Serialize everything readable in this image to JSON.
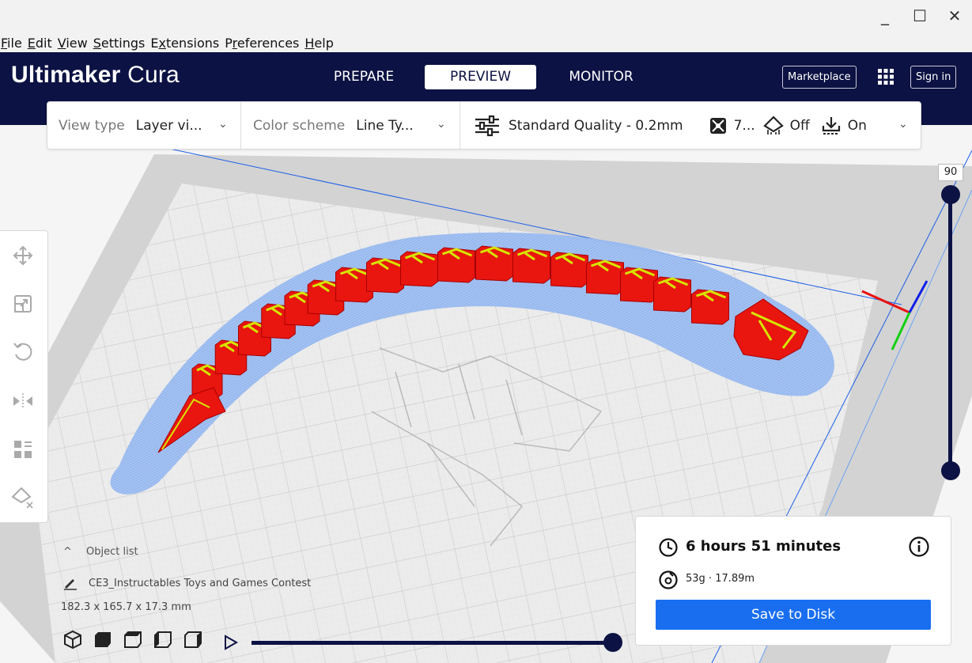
{
  "window": {
    "min": "_",
    "max": "☐",
    "close": "✕"
  },
  "menu": [
    {
      "pre": "",
      "key": "F",
      "post": "ile"
    },
    {
      "pre": "",
      "key": "E",
      "post": "dit"
    },
    {
      "pre": "",
      "key": "V",
      "post": "iew"
    },
    {
      "pre": "",
      "key": "S",
      "post": "ettings"
    },
    {
      "pre": "E",
      "key": "x",
      "post": "tensions"
    },
    {
      "pre": "P",
      "key": "r",
      "post": "eferences"
    },
    {
      "pre": "",
      "key": "H",
      "post": "elp"
    }
  ],
  "header": {
    "brand_bold": "Ultimaker",
    "brand_light": "Cura",
    "tabs": {
      "prepare": "PREPARE",
      "preview": "PREVIEW",
      "monitor": "MONITOR"
    },
    "marketplace": "Marketplace",
    "signin": "Sign in"
  },
  "settings": {
    "view_type_label": "View type",
    "view_type_value": "Layer vi...",
    "color_scheme_label": "Color scheme",
    "color_scheme_value": "Line Ty...",
    "quality": "Standard Quality - 0.2mm",
    "infill": "7...",
    "support": "Off",
    "adhesion": "On"
  },
  "layer": {
    "current": "90",
    "level": 1.0
  },
  "object_list": {
    "header": "Object list",
    "item": "CE3_Instructables Toys and Games Contest",
    "dims": "182.3 x 165.7 x 17.3 mm"
  },
  "simulation": {
    "progress": 1.0
  },
  "print": {
    "time": "6 hours 51 minutes",
    "material": "53g · 17.89m",
    "save": "Save to Disk"
  },
  "colors": {
    "header": "#0c1243",
    "accent": "#196ef0",
    "model": "#e8160f",
    "infill": "#d6e600",
    "skirt": "#8fb4ee"
  }
}
